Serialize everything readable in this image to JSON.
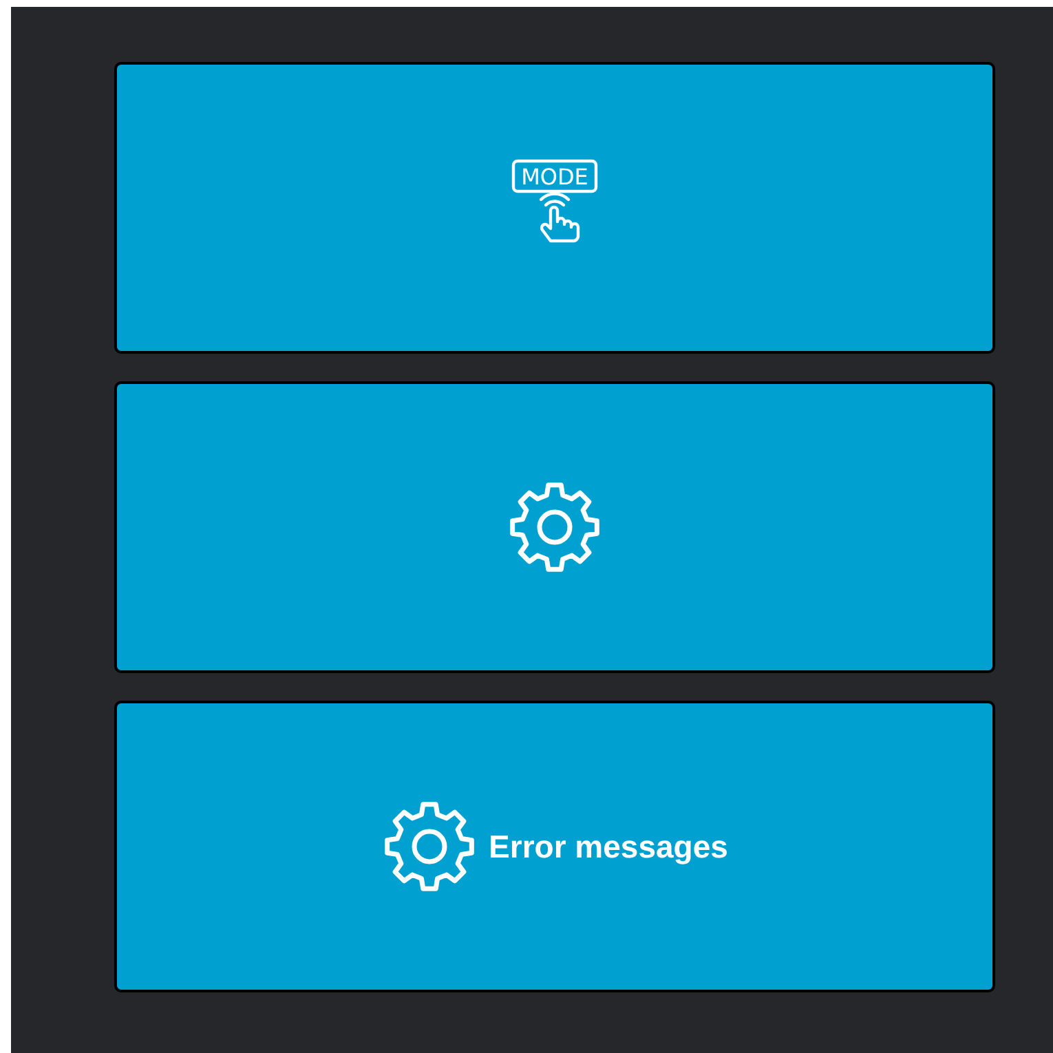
{
  "buttons": [
    {
      "kind": "mode",
      "icon_text": "MODE"
    },
    {
      "kind": "gear"
    },
    {
      "kind": "gear",
      "label": "Error messages"
    }
  ]
}
